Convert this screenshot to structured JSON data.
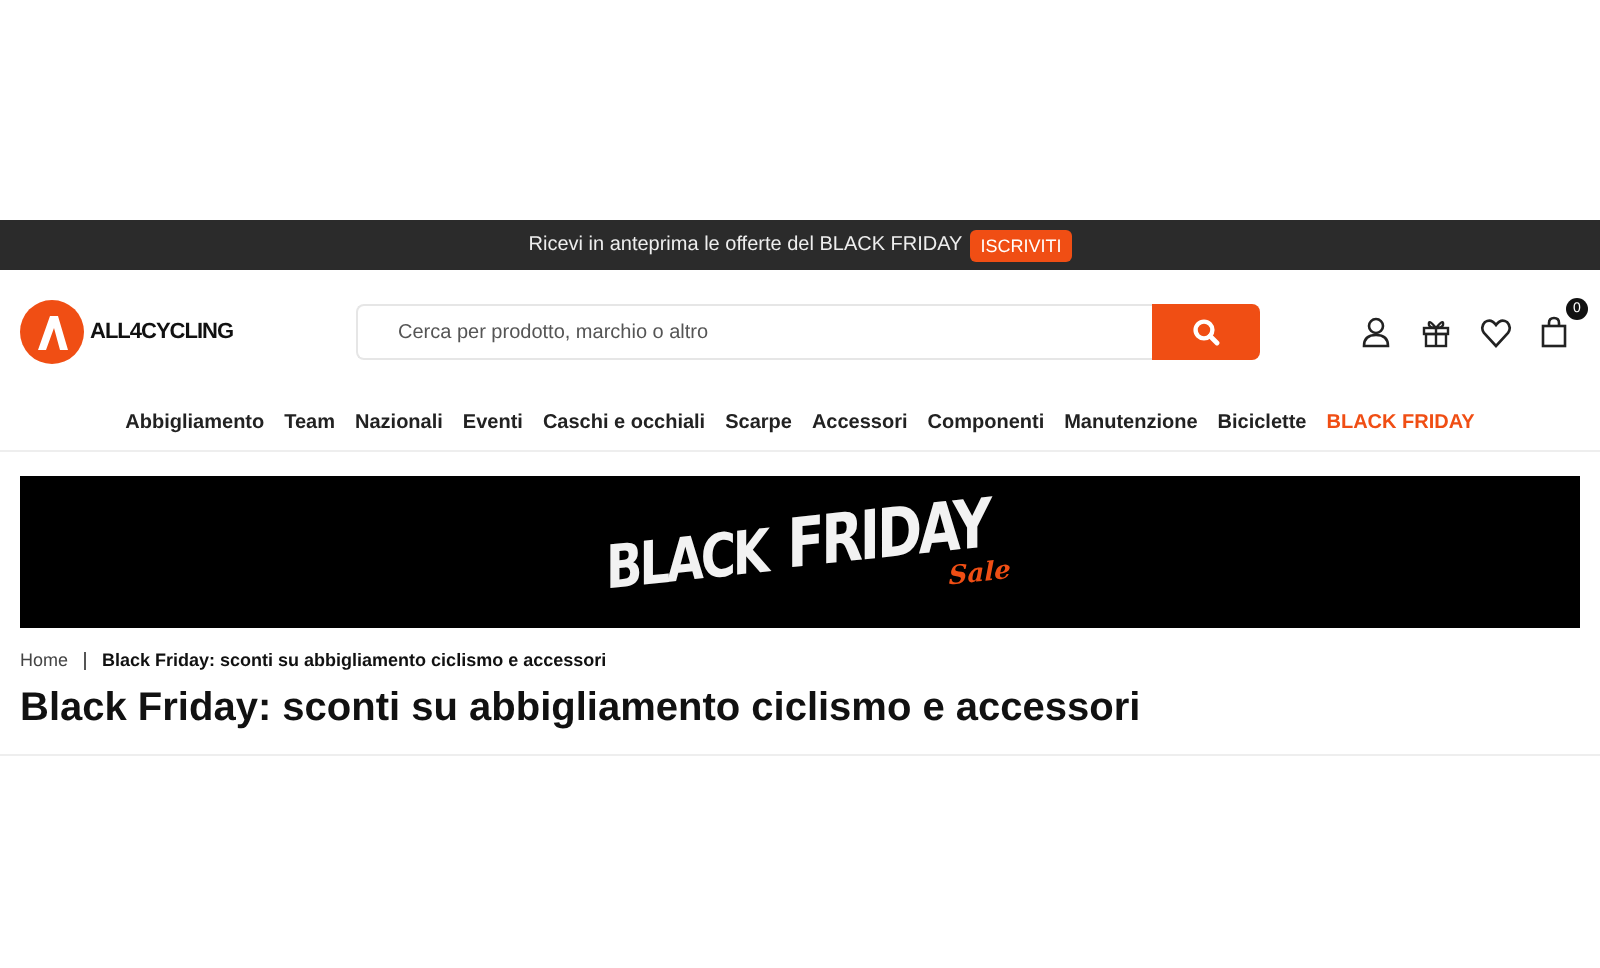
{
  "announcement": {
    "text": "Ricevi in anteprima le offerte del BLACK FRIDAY",
    "button": "ISCRIVITI"
  },
  "header": {
    "logo": "ALL4CYCLING",
    "search": {
      "placeholder": "Cerca per prodotto, marchio o altro"
    },
    "cart_count": "0"
  },
  "nav": [
    {
      "label": "Abbigliamento",
      "kind": "normal"
    },
    {
      "label": "Team",
      "kind": "normal"
    },
    {
      "label": "Nazionali",
      "kind": "normal"
    },
    {
      "label": "Eventi",
      "kind": "normal"
    },
    {
      "label": "Caschi e occhiali",
      "kind": "normal"
    },
    {
      "label": "Scarpe",
      "kind": "normal"
    },
    {
      "label": "Accessori",
      "kind": "normal"
    },
    {
      "label": "Componenti",
      "kind": "normal"
    },
    {
      "label": "Manutenzione",
      "kind": "normal"
    },
    {
      "label": "Biciclette",
      "kind": "normal"
    },
    {
      "label": "BLACK FRIDAY",
      "kind": "promo"
    }
  ],
  "banner": {
    "line_1": "BLACK",
    "line_2": "FRIDAY",
    "script": "Sale"
  },
  "breadcrumb": [
    {
      "label": "Home",
      "current": false
    },
    {
      "label": "Black Friday: sconti su abbigliamento ciclismo e accessori",
      "current": true
    }
  ],
  "page_title": "Black Friday: sconti su abbigliamento ciclismo e accessori"
}
